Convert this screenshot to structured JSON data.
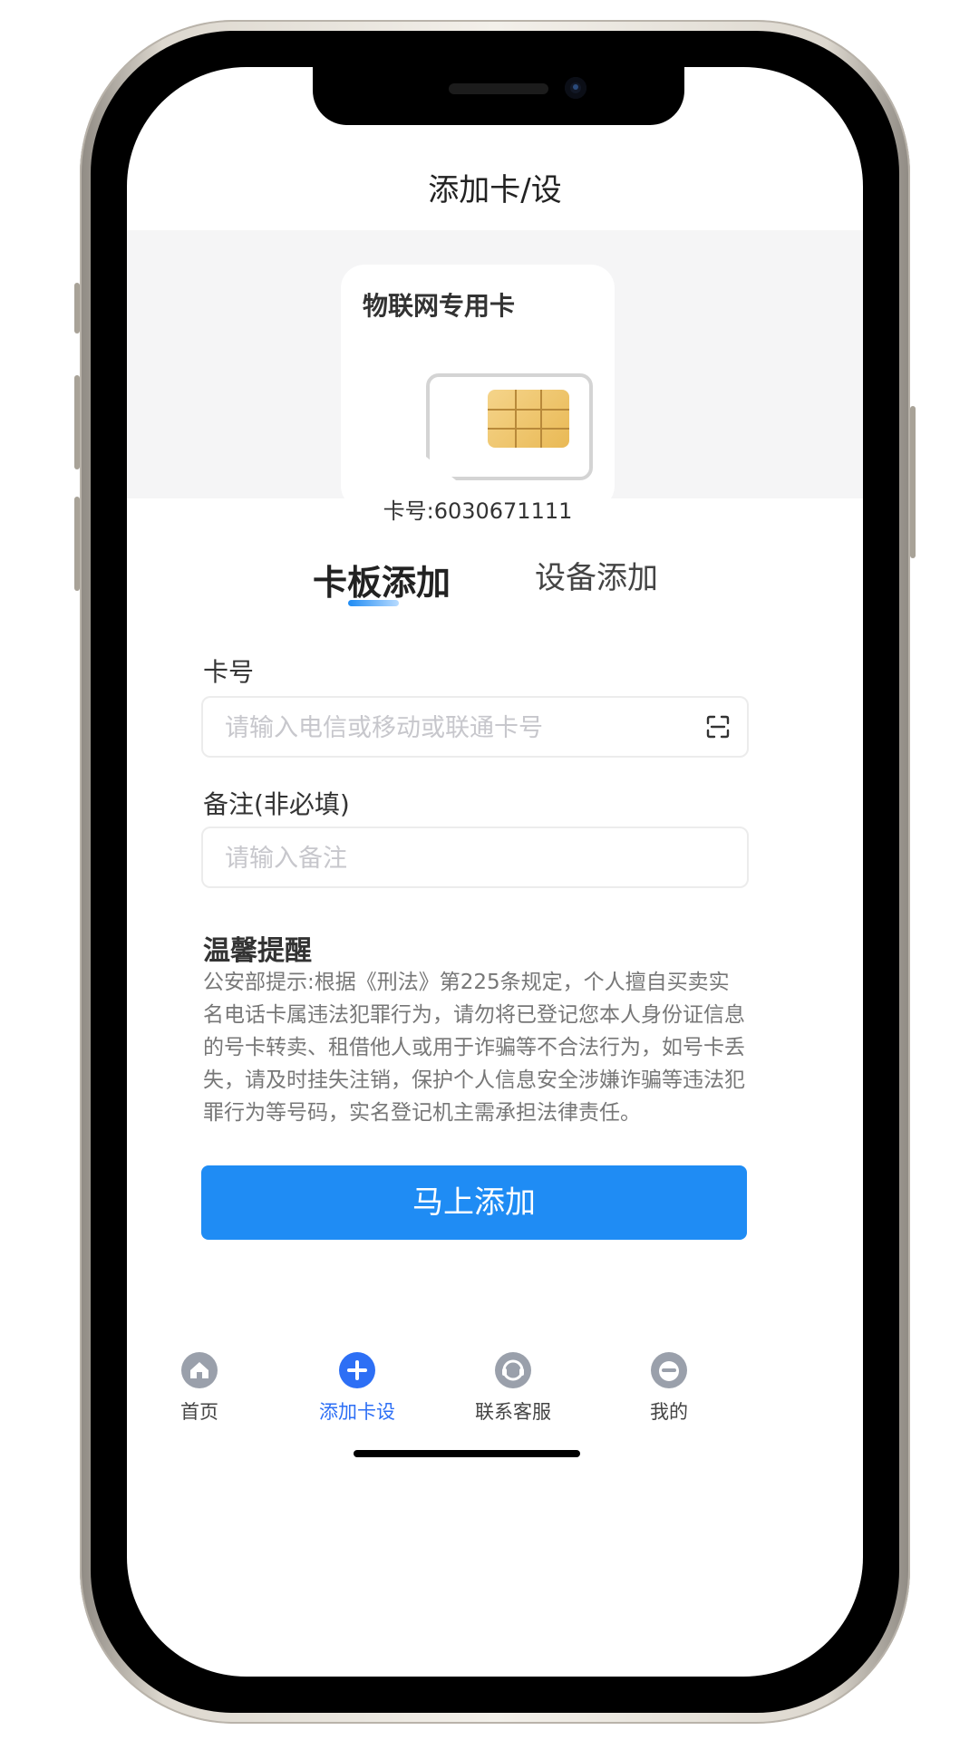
{
  "header": {
    "title": "添加卡/设"
  },
  "card_preview": {
    "title": "物联网专用卡",
    "number_label": "卡号:6030671111"
  },
  "tabs": [
    {
      "label": "卡板添加",
      "active": true
    },
    {
      "label": "设备添加",
      "active": false
    }
  ],
  "form": {
    "card_number": {
      "label": "卡号",
      "value": "",
      "placeholder": "请输入电信或移动或联通卡号",
      "icon": "scan-icon"
    },
    "remark": {
      "label": "备注(非必填)",
      "value": "",
      "placeholder": "请输入备注"
    }
  },
  "notice": {
    "title": "温馨提醒",
    "text": "公安部提示:根据《刑法》第225条规定，个人擅自买卖实名电话卡属违法犯罪行为，请勿将已登记您本人身份证信息的号卡转卖、租借他人或用于诈骗等不合法行为，如号卡丢失，请及时挂失注销，保护个人信息安全涉嫌诈骗等违法犯罪行为等号码，实名登记机主需承担法律责任。"
  },
  "submit": {
    "label": "马上添加"
  },
  "tabbar": {
    "items": [
      {
        "label": "首页",
        "icon": "home-icon",
        "active": false
      },
      {
        "label": "添加卡设",
        "icon": "add-icon",
        "active": true
      },
      {
        "label": "联系客服",
        "icon": "customer-service-icon",
        "active": false
      },
      {
        "label": "我的",
        "icon": "profile-icon",
        "active": false
      }
    ]
  },
  "colors": {
    "accent": "#1f8cf4",
    "tab_active": "#2d6ff5",
    "inactive_icon": "#9aa0ab"
  }
}
